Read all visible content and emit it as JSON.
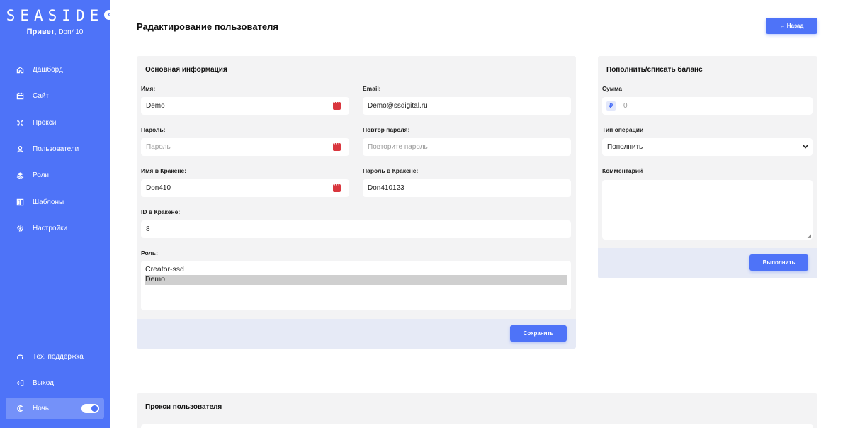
{
  "sidebar": {
    "logo": "SEASIDE",
    "collapse_icon": "‹",
    "greeting_label": "Привет,",
    "greeting_user": "Don410",
    "items": [
      {
        "label": "Дашборд",
        "icon": "home-icon"
      },
      {
        "label": "Сайт",
        "icon": "calendar-icon"
      },
      {
        "label": "Прокси",
        "icon": "proxy-icon"
      },
      {
        "label": "Пользователи",
        "icon": "user-icon"
      },
      {
        "label": "Роли",
        "icon": "layers-icon"
      },
      {
        "label": "Шаблоны",
        "icon": "template-icon"
      },
      {
        "label": "Настройки",
        "icon": "gear-icon"
      }
    ],
    "bottom": [
      {
        "label": "Тех. поддержка",
        "icon": "headset-icon"
      },
      {
        "label": "Выход",
        "icon": "logout-icon"
      }
    ],
    "night_label": "Ночь",
    "night_enabled": true
  },
  "header": {
    "title": "Радактирование пользователя",
    "back_label": "← Назад"
  },
  "main_card": {
    "title": "Основная информация",
    "name_label": "Имя:",
    "name_value": "Demo",
    "email_label": "Email:",
    "email_value": "Demo@ssdigital.ru",
    "password_label": "Пароль:",
    "password_placeholder": "Пароль",
    "password_repeat_label": "Повтор пароля:",
    "password_repeat_placeholder": "Повторите пароль",
    "kraken_name_label": "Имя в Кракене:",
    "kraken_name_value": "Don410",
    "kraken_password_label": "Пароль в Кракене:",
    "kraken_password_value": "Don410123",
    "kraken_id_label": "ID в Кракене:",
    "kraken_id_value": "8",
    "role_label": "Роль:",
    "roles": [
      {
        "label": "Creator-ssd",
        "selected": false
      },
      {
        "label": "Demo",
        "selected": true
      }
    ],
    "save_label": "Сохранить"
  },
  "balance_card": {
    "title": "Пополнить/списать баланс",
    "amount_label": "Сумма",
    "currency_symbol": "₽",
    "amount_placeholder": "0",
    "operation_label": "Тип операции",
    "operation_value": "Пополнить",
    "comment_label": "Комментарий",
    "submit_label": "Выполнить"
  },
  "proxy_card": {
    "title": "Прокси пользователя"
  },
  "colors": {
    "accent": "#4e73f8",
    "card_bg": "#f3f3f4",
    "footer_bg": "#e6eaf6",
    "keepass_red": "#d9363e"
  }
}
